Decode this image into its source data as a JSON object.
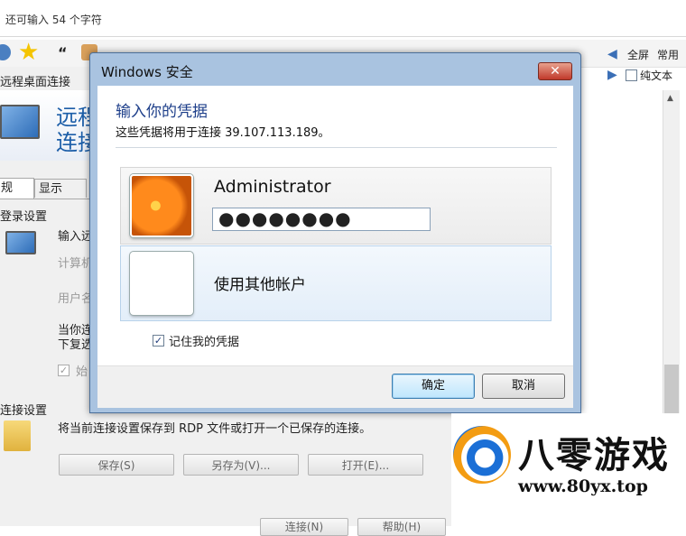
{
  "top": {
    "char_hint": "还可输入 54 个字符"
  },
  "right_panel": {
    "fullscreen": "全屏",
    "common": "常用",
    "plain_text": "纯文本"
  },
  "rdp": {
    "window_title": "远程桌面连接",
    "banner_line1": "远程",
    "banner_line2": "连接",
    "tabs": [
      "规",
      "显示"
    ],
    "login_section": "登录设置",
    "input_hint": "输入远",
    "computer_label": "计算机",
    "user_label": "用户名",
    "note_line1": "当你连",
    "note_line2": "下复选",
    "always_label": "始",
    "conn_section": "连接设置",
    "conn_desc": "将当前连接设置保存到 RDP 文件或打开一个已保存的连接。",
    "save_btn": "保存(S)",
    "saveas_btn": "另存为(V)...",
    "open_btn": "打开(E)...",
    "connect_btn": "连接(N)",
    "help_btn": "帮助(H)"
  },
  "dialog": {
    "title": "Windows 安全",
    "close_glyph": "✕",
    "heading": "输入你的凭据",
    "subtitle": "这些凭据将用于连接 39.107.113.189。",
    "username": "Administrator",
    "password_mask": "●●●●●●●●",
    "other_account": "使用其他帐户",
    "remember_label": "记住我的凭据",
    "remember_checked": true,
    "ok_btn": "确定",
    "cancel_btn": "取消"
  },
  "logo": {
    "brand": "八零游戏",
    "url": "www.80yx.top"
  }
}
